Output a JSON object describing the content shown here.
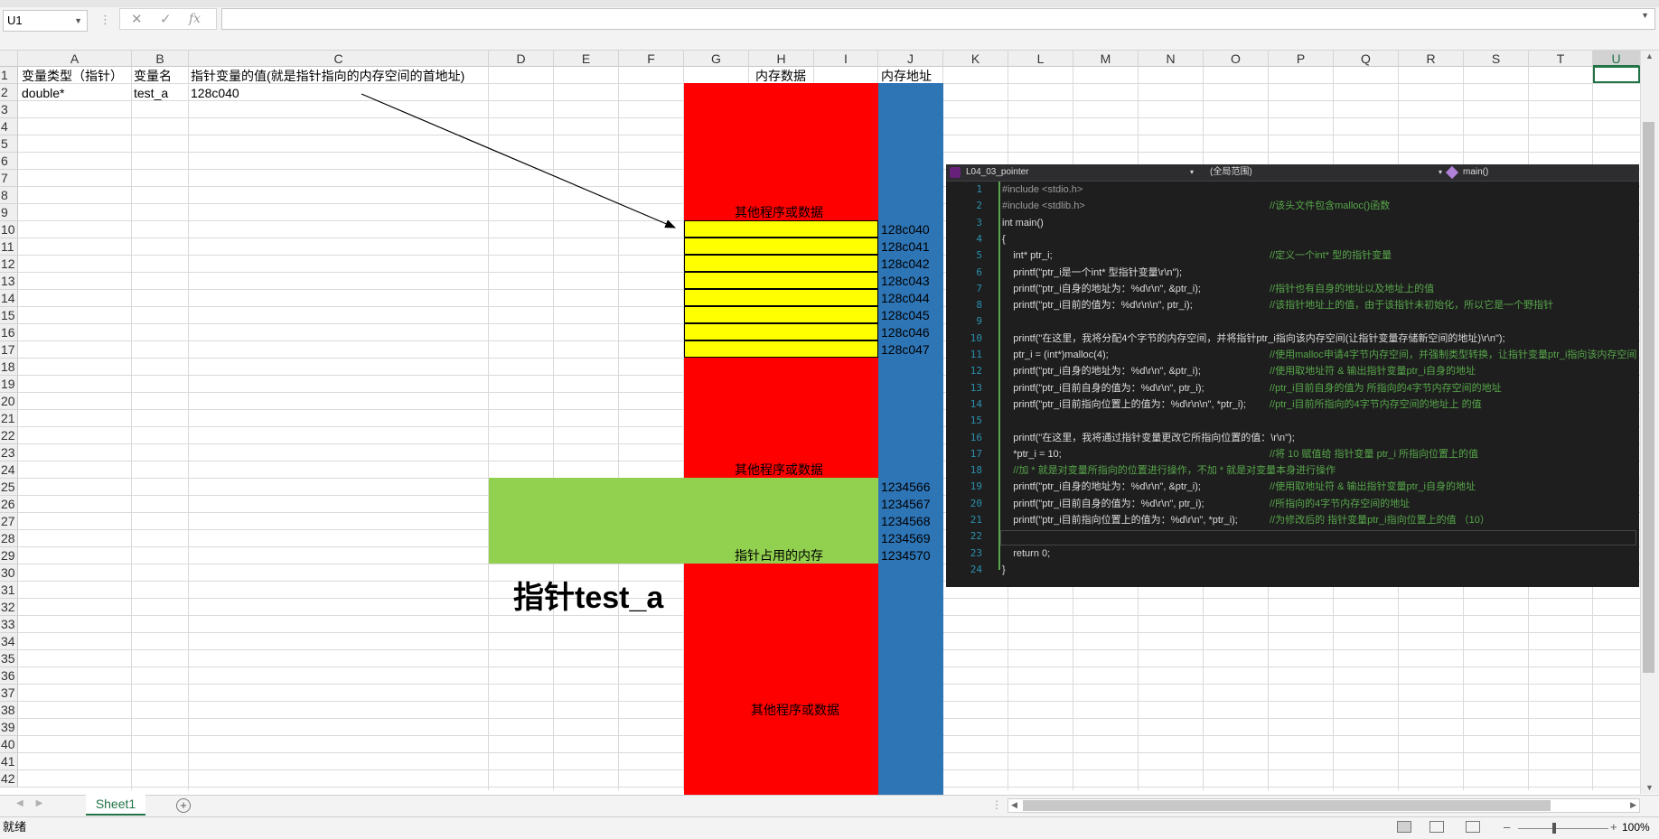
{
  "formula_bar": {
    "name_box": "U1",
    "fx_label": "fx",
    "cancel_glyph": "✕",
    "enter_glyph": "✓",
    "formula_value": ""
  },
  "columns": [
    "A",
    "B",
    "C",
    "D",
    "E",
    "F",
    "G",
    "H",
    "I",
    "J",
    "K",
    "L",
    "M",
    "N",
    "O",
    "P",
    "Q",
    "R",
    "S",
    "T",
    "U"
  ],
  "selected_column": "U",
  "rows": [
    "1",
    "2",
    "3",
    "4",
    "5",
    "6",
    "7",
    "8",
    "9",
    "10",
    "11",
    "12",
    "13",
    "14",
    "15",
    "16",
    "17",
    "18",
    "19",
    "20",
    "21",
    "22",
    "23",
    "24",
    "25",
    "26",
    "27",
    "28",
    "29",
    "30",
    "31",
    "32",
    "33",
    "34",
    "35",
    "36",
    "37",
    "38",
    "39",
    "40",
    "41",
    "42"
  ],
  "cells": {
    "A1": "变量类型（指针）",
    "B1": "变量名",
    "C1": "指针变量的值(就是指针指向的内存空间的首地址)",
    "A2": "double*",
    "B2": "test_a",
    "C2": "128c040",
    "H1": "内存数据",
    "J1": "内存地址"
  },
  "memory": {
    "label_top": "其他程序或数据",
    "addresses_a": [
      "128c040",
      "128c041",
      "128c042",
      "128c043",
      "128c044",
      "128c045",
      "128c046",
      "128c047"
    ],
    "label_mid": "其他程序或数据",
    "addresses_b": [
      "1234566",
      "1234567",
      "1234568",
      "1234569",
      "1234570"
    ],
    "pointer_label": "指针占用的内存",
    "big_label": "指针test_a",
    "label_bottom": "其他程序或数据",
    "colors": {
      "red": "#ff0000",
      "blue": "#2e75b6",
      "yellow": "#ffff00",
      "green": "#92d050"
    }
  },
  "code_editor": {
    "project": "L04_03_pointer",
    "scope": "(全局范围)",
    "function": "main()",
    "lines": [
      {
        "n": "1",
        "code": "#include <stdio.h>",
        "comment": ""
      },
      {
        "n": "2",
        "code": "#include <stdlib.h>",
        "comment": "//该头文件包含malloc()函数"
      },
      {
        "n": "3",
        "code": "int main()",
        "comment": ""
      },
      {
        "n": "4",
        "code": "{",
        "comment": ""
      },
      {
        "n": "5",
        "code": "    int* ptr_i;",
        "comment": "//定义一个int* 型的指针变量"
      },
      {
        "n": "6",
        "code": "    printf(\"ptr_i是一个int* 型指针变量\\r\\n\");",
        "comment": ""
      },
      {
        "n": "7",
        "code": "    printf(\"ptr_i自身的地址为：%d\\r\\n\", &ptr_i);",
        "comment": "//指针也有自身的地址以及地址上的值"
      },
      {
        "n": "8",
        "code": "    printf(\"ptr_i目前的值为：%d\\r\\n\\n\", ptr_i);",
        "comment": "//该指针地址上的值，由于该指针未初始化，所以它是一个野指针"
      },
      {
        "n": "9",
        "code": "",
        "comment": ""
      },
      {
        "n": "10",
        "code": "    printf(\"在这里，我将分配4个字节的内存空间，并将指针ptr_i指向该内存空间(让指针变量存储新空间的地址)\\r\\n\");",
        "comment": ""
      },
      {
        "n": "11",
        "code": "    ptr_i = (int*)malloc(4);",
        "comment": "//使用malloc申请4字节内存空间，并强制类型转换，让指针变量ptr_i指向该内存空间"
      },
      {
        "n": "12",
        "code": "    printf(\"ptr_i自身的地址为：%d\\r\\n\", &ptr_i);",
        "comment": "//使用取地址符 & 输出指针变量ptr_i自身的地址"
      },
      {
        "n": "13",
        "code": "    printf(\"ptr_i目前自身的值为：%d\\r\\n\", ptr_i);",
        "comment": "//ptr_i目前自身的值为 所指向的4字节内存空间的地址"
      },
      {
        "n": "14",
        "code": "    printf(\"ptr_i目前指向位置上的值为：%d\\r\\n\\n\", *ptr_i);",
        "comment": "//ptr_i目前所指向的4字节内存空间的地址上 的值"
      },
      {
        "n": "15",
        "code": "",
        "comment": ""
      },
      {
        "n": "16",
        "code": "    printf(\"在这里，我将通过指针变量更改它所指向位置的值：\\r\\n\");",
        "comment": ""
      },
      {
        "n": "17",
        "code": "    *ptr_i = 10;",
        "comment": "//将 10 赋值给 指针变量 ptr_i 所指向位置上的值"
      },
      {
        "n": "18",
        "code": "    //加 * 就是对变量所指向的位置进行操作，不加 * 就是对变量本身进行操作",
        "comment": ""
      },
      {
        "n": "19",
        "code": "    printf(\"ptr_i自身的地址为：%d\\r\\n\", &ptr_i);",
        "comment": "//使用取地址符 & 输出指针变量ptr_i自身的地址"
      },
      {
        "n": "20",
        "code": "    printf(\"ptr_i目前自身的值为：%d\\r\\n\", ptr_i);",
        "comment": "//所指向的4字节内存空间的地址"
      },
      {
        "n": "21",
        "code": "    printf(\"ptr_i目前指向位置上的值为：%d\\r\\n\", *ptr_i);",
        "comment": "//为修改后的 指针变量ptr_i指向位置上的值 （10）"
      },
      {
        "n": "22",
        "code": "",
        "comment": ""
      },
      {
        "n": "23",
        "code": "    return 0;",
        "comment": ""
      },
      {
        "n": "24",
        "code": "}",
        "comment": ""
      }
    ]
  },
  "sheet_tabs": {
    "active": "Sheet1",
    "add_glyph": "+"
  },
  "status": {
    "text": "就绪",
    "zoom": "100%"
  }
}
